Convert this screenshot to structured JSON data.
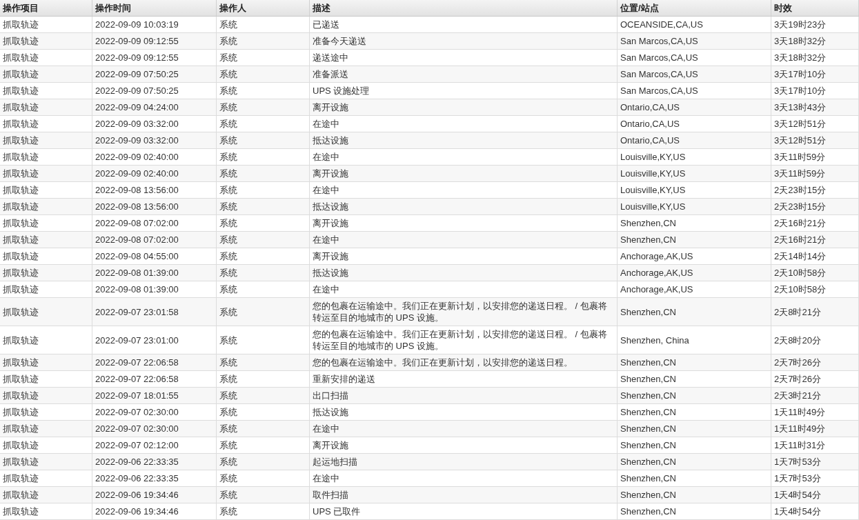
{
  "table": {
    "columns": [
      "操作项目",
      "操作时间",
      "操作人",
      "描述",
      "位置/站点",
      "时效"
    ],
    "rows": [
      [
        "抓取轨迹",
        "2022-09-09 10:03:19",
        "系统",
        "已递送",
        "OCEANSIDE,CA,US",
        "3天19时23分"
      ],
      [
        "抓取轨迹",
        "2022-09-09 09:12:55",
        "系统",
        "准备今天递送",
        "San Marcos,CA,US",
        "3天18时32分"
      ],
      [
        "抓取轨迹",
        "2022-09-09 09:12:55",
        "系统",
        "递送途中",
        "San Marcos,CA,US",
        "3天18时32分"
      ],
      [
        "抓取轨迹",
        "2022-09-09 07:50:25",
        "系统",
        "准备派送",
        "San Marcos,CA,US",
        "3天17时10分"
      ],
      [
        "抓取轨迹",
        "2022-09-09 07:50:25",
        "系统",
        "UPS 设施处理",
        "San Marcos,CA,US",
        "3天17时10分"
      ],
      [
        "抓取轨迹",
        "2022-09-09 04:24:00",
        "系统",
        "离开设施",
        "Ontario,CA,US",
        "3天13时43分"
      ],
      [
        "抓取轨迹",
        "2022-09-09 03:32:00",
        "系统",
        "在途中",
        "Ontario,CA,US",
        "3天12时51分"
      ],
      [
        "抓取轨迹",
        "2022-09-09 03:32:00",
        "系统",
        "抵达设施",
        "Ontario,CA,US",
        "3天12时51分"
      ],
      [
        "抓取轨迹",
        "2022-09-09 02:40:00",
        "系统",
        "在途中",
        "Louisville,KY,US",
        "3天11时59分"
      ],
      [
        "抓取轨迹",
        "2022-09-09 02:40:00",
        "系统",
        "离开设施",
        "Louisville,KY,US",
        "3天11时59分"
      ],
      [
        "抓取轨迹",
        "2022-09-08 13:56:00",
        "系统",
        "在途中",
        "Louisville,KY,US",
        "2天23时15分"
      ],
      [
        "抓取轨迹",
        "2022-09-08 13:56:00",
        "系统",
        "抵达设施",
        "Louisville,KY,US",
        "2天23时15分"
      ],
      [
        "抓取轨迹",
        "2022-09-08 07:02:00",
        "系统",
        "离开设施",
        "Shenzhen,CN",
        "2天16时21分"
      ],
      [
        "抓取轨迹",
        "2022-09-08 07:02:00",
        "系统",
        "在途中",
        "Shenzhen,CN",
        "2天16时21分"
      ],
      [
        "抓取轨迹",
        "2022-09-08 04:55:00",
        "系统",
        "离开设施",
        "Anchorage,AK,US",
        "2天14时14分"
      ],
      [
        "抓取轨迹",
        "2022-09-08 01:39:00",
        "系统",
        "抵达设施",
        "Anchorage,AK,US",
        "2天10时58分"
      ],
      [
        "抓取轨迹",
        "2022-09-08 01:39:00",
        "系统",
        "在途中",
        "Anchorage,AK,US",
        "2天10时58分"
      ],
      [
        "抓取轨迹",
        "2022-09-07 23:01:58",
        "系统",
        "您的包裹在运输途中。我们正在更新计划，以安排您的递送日程。 / 包裹将转运至目的地城市的 UPS 设施。",
        "Shenzhen,CN",
        "2天8时21分"
      ],
      [
        "抓取轨迹",
        "2022-09-07 23:01:00",
        "系统",
        "您的包裹在运输途中。我们正在更新计划，以安排您的递送日程。 / 包裹将转运至目的地城市的 UPS 设施。",
        "Shenzhen, China",
        "2天8时20分"
      ],
      [
        "抓取轨迹",
        "2022-09-07 22:06:58",
        "系统",
        "您的包裹在运输途中。我们正在更新计划，以安排您的递送日程。",
        "Shenzhen,CN",
        "2天7时26分"
      ],
      [
        "抓取轨迹",
        "2022-09-07 22:06:58",
        "系统",
        "重新安排的递送",
        "Shenzhen,CN",
        "2天7时26分"
      ],
      [
        "抓取轨迹",
        "2022-09-07 18:01:55",
        "系统",
        "出口扫描",
        "Shenzhen,CN",
        "2天3时21分"
      ],
      [
        "抓取轨迹",
        "2022-09-07 02:30:00",
        "系统",
        "抵达设施",
        "Shenzhen,CN",
        "1天11时49分"
      ],
      [
        "抓取轨迹",
        "2022-09-07 02:30:00",
        "系统",
        "在途中",
        "Shenzhen,CN",
        "1天11时49分"
      ],
      [
        "抓取轨迹",
        "2022-09-07 02:12:00",
        "系统",
        "离开设施",
        "Shenzhen,CN",
        "1天11时31分"
      ],
      [
        "抓取轨迹",
        "2022-09-06 22:33:35",
        "系统",
        "起运地扫描",
        "Shenzhen,CN",
        "1天7时53分"
      ],
      [
        "抓取轨迹",
        "2022-09-06 22:33:35",
        "系统",
        "在途中",
        "Shenzhen,CN",
        "1天7时53分"
      ],
      [
        "抓取轨迹",
        "2022-09-06 19:34:46",
        "系统",
        "取件扫描",
        "Shenzhen,CN",
        "1天4时54分"
      ],
      [
        "抓取轨迹",
        "2022-09-06 19:34:46",
        "系统",
        "UPS 已取件",
        "Shenzhen,CN",
        "1天4时54分"
      ]
    ]
  }
}
